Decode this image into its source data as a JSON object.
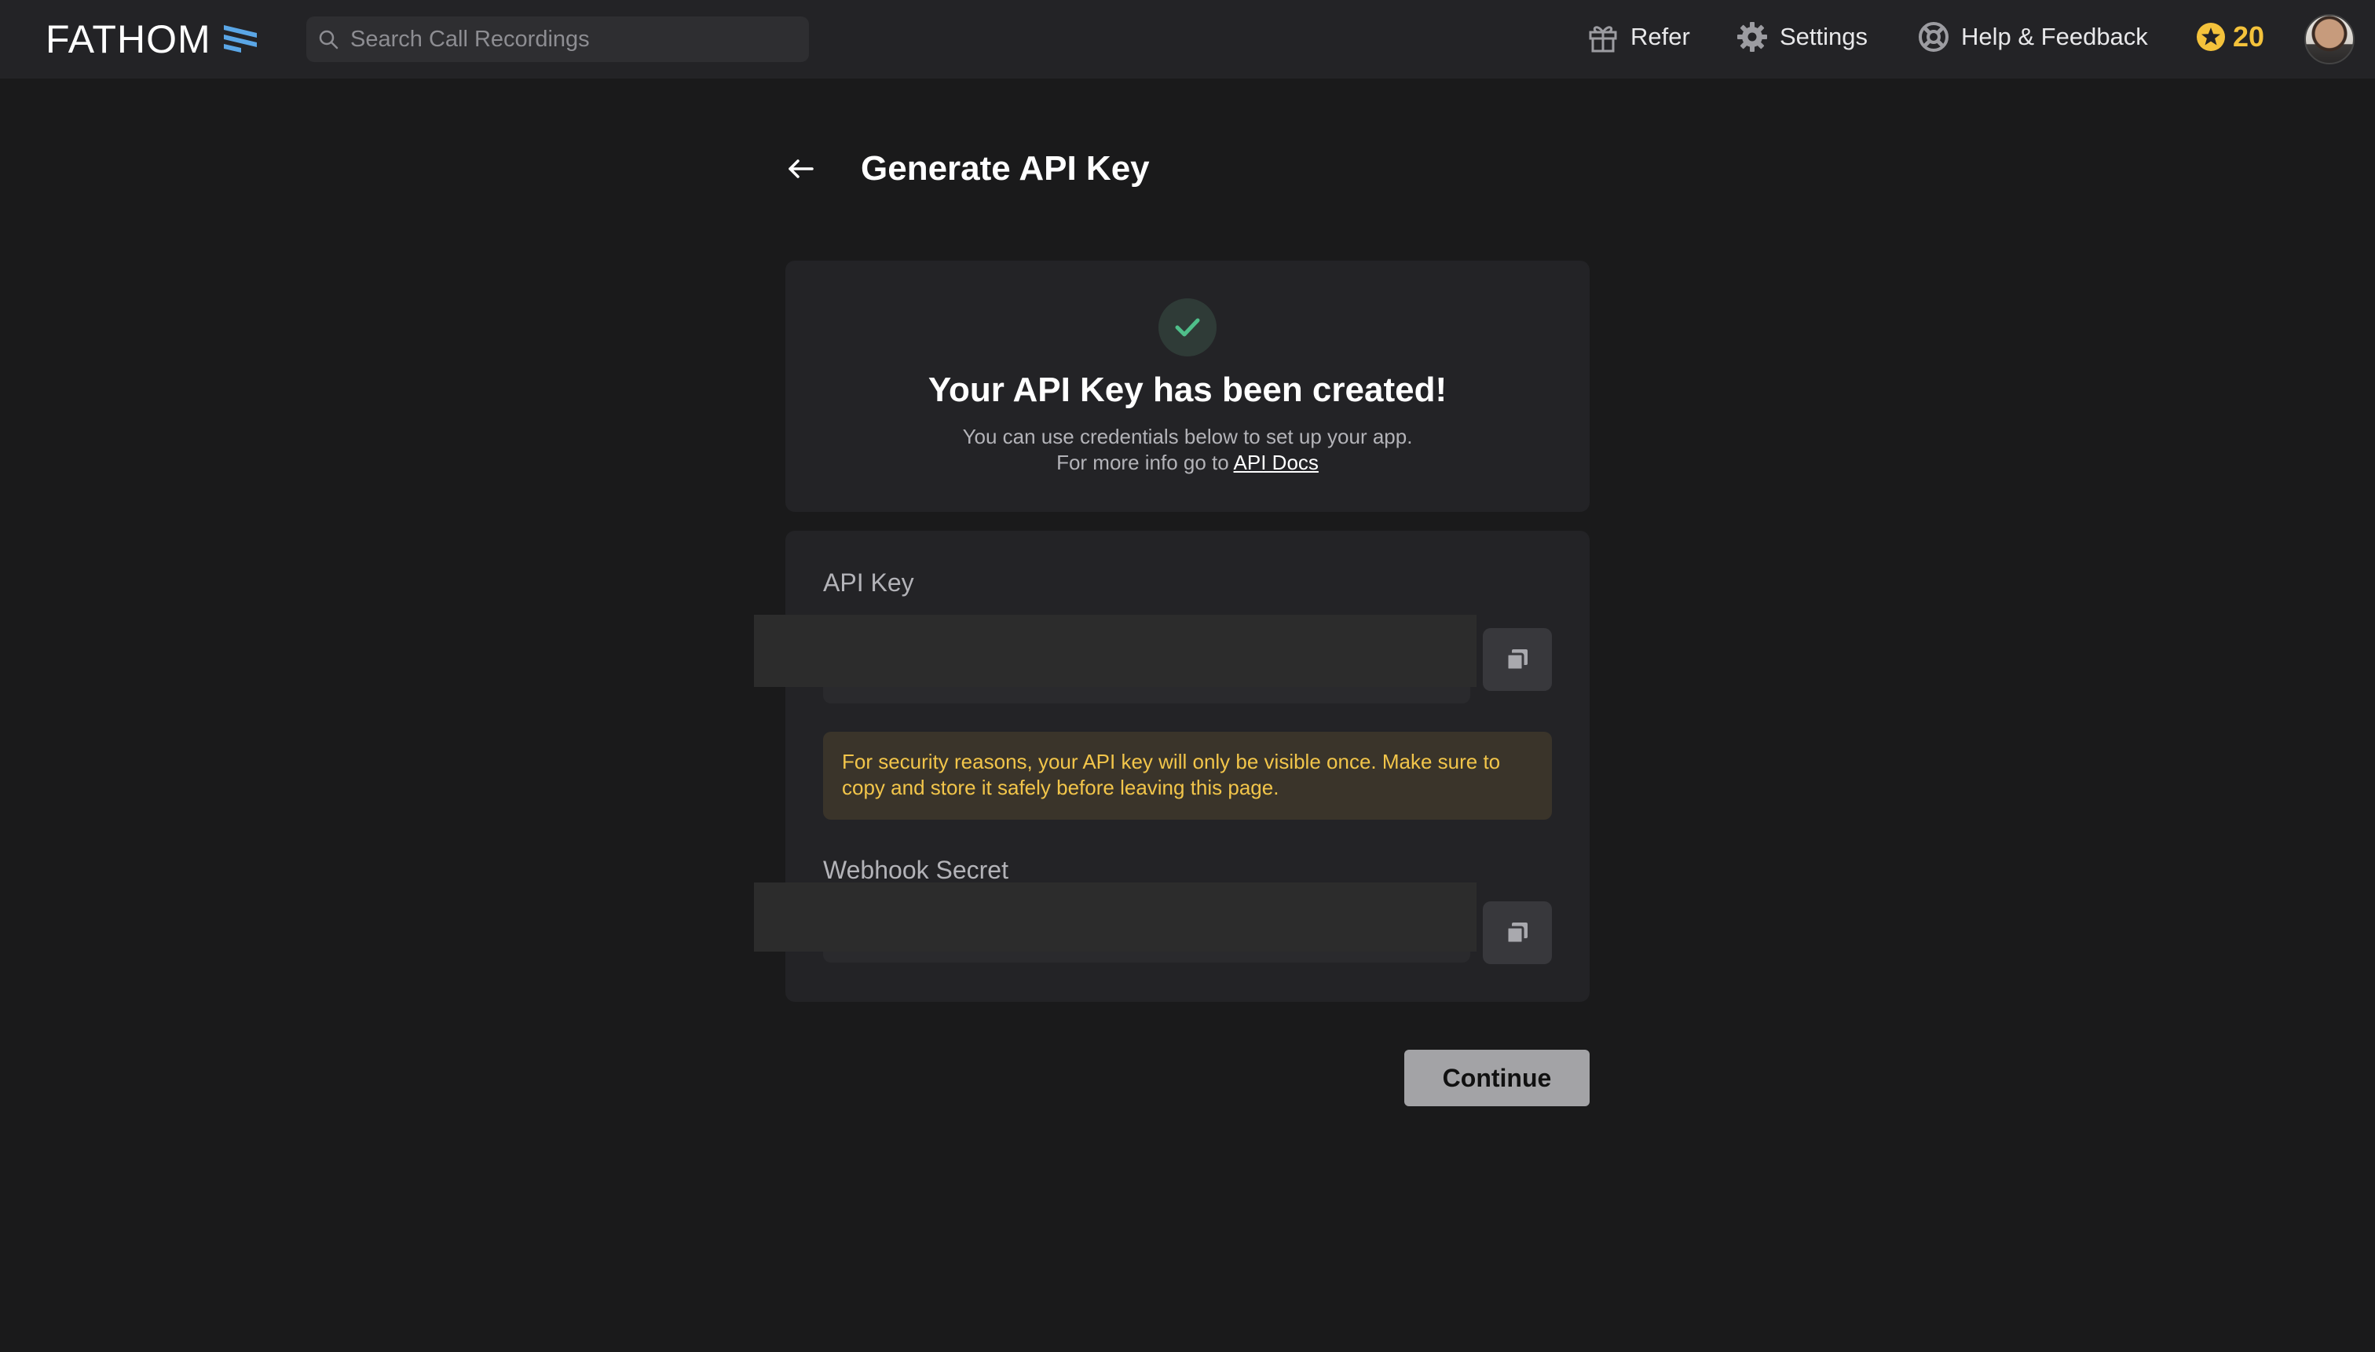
{
  "header": {
    "logo_text": "FATHOM",
    "search_placeholder": "Search Call Recordings",
    "nav": {
      "refer": "Refer",
      "settings": "Settings",
      "help": "Help & Feedback",
      "points": "20"
    }
  },
  "page": {
    "title": "Generate API Key"
  },
  "success": {
    "title": "Your API Key has been created!",
    "line1": "You can use credentials below to set up your app.",
    "line2_prefix": "For more info go to",
    "docs_link": "API Docs"
  },
  "credentials": {
    "api_key_label": "API Key",
    "warning": "For security reasons, your API key will only be visible once. Make sure to copy and store it safely before leaving this page.",
    "webhook_label": "Webhook Secret"
  },
  "actions": {
    "continue": "Continue"
  },
  "colors": {
    "background": "#1a1a1b",
    "panel": "#232326",
    "warning_text": "#f2c54a",
    "points": "#f4c23b",
    "success_check": "#4fbf8a"
  }
}
